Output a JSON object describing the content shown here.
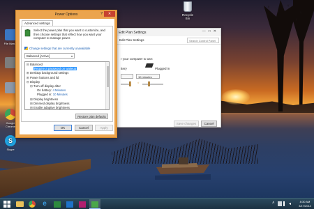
{
  "desktop": {
    "recycle_bin_label": "Recycle Bin",
    "icons": [
      {
        "name": "desktop-icon-file-manager",
        "label": "File Man...",
        "color": "#3a76c4"
      },
      {
        "name": "desktop-icon-app",
        "label": "",
        "color": "#7d7d7d"
      },
      {
        "name": "desktop-icon-computer",
        "label": "",
        "color": "#8e99a8"
      },
      {
        "name": "desktop-icon-chrome",
        "label": "Google Chrome",
        "color": "#d64b3a"
      },
      {
        "name": "desktop-icon-skype",
        "label": "Skype",
        "color": "#1fa2e0"
      }
    ]
  },
  "bg_window": {
    "title": "Edit Plan Settings",
    "breadcrumb": "Edit Plan Settings",
    "search_placeholder": "Search Control Panel",
    "text_for_your_computer": "r your computer to use:",
    "battery_label": "ttery",
    "plugged_in_label": "Plugged in",
    "plugged_in_value": "10 minutes",
    "save_label": "Save changes",
    "cancel_label": "Cancel"
  },
  "dialog": {
    "title": "Power Options",
    "help_label": "?",
    "close_label": "✕",
    "tab_label": "Advanced settings",
    "intro": "Select the power plan that you want to customize, and then choose settings that reflect how you want your computer to manage power.",
    "change_link": "Change settings that are currently unavailable",
    "plan_value": "Balanced [Active]",
    "tree": [
      {
        "toggle": "⊟",
        "indent": 0,
        "text": "Balanced",
        "value": "",
        "selected": false
      },
      {
        "toggle": "",
        "indent": 1,
        "text": "Require a password on wakeup",
        "value": "",
        "selected": true
      },
      {
        "toggle": "⊞",
        "indent": 0,
        "text": "Desktop background settings",
        "value": "",
        "selected": false
      },
      {
        "toggle": "⊞",
        "indent": 0,
        "text": "Power buttons and lid",
        "value": "",
        "selected": false
      },
      {
        "toggle": "⊟",
        "indent": 0,
        "text": "Display",
        "value": "",
        "selected": false
      },
      {
        "toggle": "⊟",
        "indent": 1,
        "text": "Turn off display after",
        "value": "",
        "selected": false
      },
      {
        "toggle": "",
        "indent": 2,
        "text": "On battery:",
        "value": "4 Minutes",
        "selected": false
      },
      {
        "toggle": "",
        "indent": 2,
        "text": "Plugged in:",
        "value": "10 Minutes",
        "selected": false
      },
      {
        "toggle": "⊞",
        "indent": 1,
        "text": "Display brightness",
        "value": "",
        "selected": false
      },
      {
        "toggle": "⊞",
        "indent": 1,
        "text": "Dimmed display brightness",
        "value": "",
        "selected": false
      },
      {
        "toggle": "⊞",
        "indent": 1,
        "text": "Enable adaptive brightness",
        "value": "",
        "selected": false
      }
    ],
    "restore_label": "Restore plan defaults",
    "ok_label": "OK",
    "cancel_label": "Cancel",
    "apply_label": "Apply"
  },
  "taskbar": {
    "time": "8:30 AM",
    "date": "3/17/2014",
    "accent": "#1b3142"
  }
}
